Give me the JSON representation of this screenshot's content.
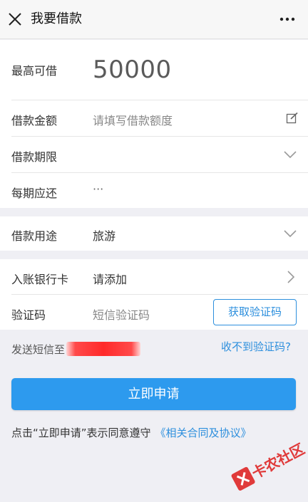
{
  "header": {
    "title": "我要借款",
    "close_icon": "close-icon",
    "more_icon": "more-icon"
  },
  "max_loan": {
    "label": "最高可借",
    "amount": "50000"
  },
  "loan_amount": {
    "label": "借款金额",
    "placeholder": "请填写借款额度",
    "icon": "edit-icon"
  },
  "loan_term": {
    "label": "借款期限",
    "icon": "chevron-down-icon"
  },
  "installment": {
    "label": "每期应还",
    "value": "···"
  },
  "loan_purpose": {
    "label": "借款用途",
    "value": "旅游",
    "icon": "chevron-down-icon"
  },
  "bank_card": {
    "label": "入账银行卡",
    "value": "请添加",
    "icon": "chevron-right-icon"
  },
  "verify_code": {
    "label": "验证码",
    "placeholder": "短信验证码",
    "button": "获取验证码"
  },
  "sms": {
    "sent_to": "发送短信至",
    "no_code_link": "收不到验证码?"
  },
  "apply_button": "立即申请",
  "agreement": {
    "text": "点击“立即申请”表示同意遵守",
    "link": "《相关合同及协议》"
  },
  "watermark": {
    "text": "卡农社区"
  },
  "colors": {
    "accent": "#2d8fdd",
    "button": "#2d9aee",
    "background": "#efeff4",
    "mask": "#ff2a2a"
  }
}
